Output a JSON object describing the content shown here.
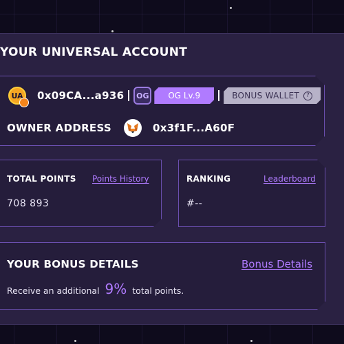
{
  "title": "YOUR UNIVERSAL ACCOUNT",
  "account": {
    "logo_text": "UA",
    "address": "0x09CA...a936",
    "og_badge_text": "OG",
    "og_level": "OG Lv.9",
    "bonus_wallet_label": "BONUS WALLET",
    "help_glyph": "?"
  },
  "owner": {
    "label": "OWNER ADDRESS",
    "address": "0x3f1F...A60F",
    "wallet_icon": "metamask-fox-icon"
  },
  "points": {
    "label": "TOTAL POINTS",
    "link": "Points History",
    "value": "708 893"
  },
  "ranking": {
    "label": "RANKING",
    "link": "Leaderboard",
    "value": "#--"
  },
  "bonus": {
    "title": "YOUR BONUS DETAILS",
    "link": "Bonus Details",
    "text_before": "Receive an additional",
    "percent": "9%",
    "text_after": "total points."
  },
  "colors": {
    "accent": "#b07bff",
    "panel": "#2a2142",
    "border": "#6b4fb0",
    "background": "#0e0b1c"
  }
}
